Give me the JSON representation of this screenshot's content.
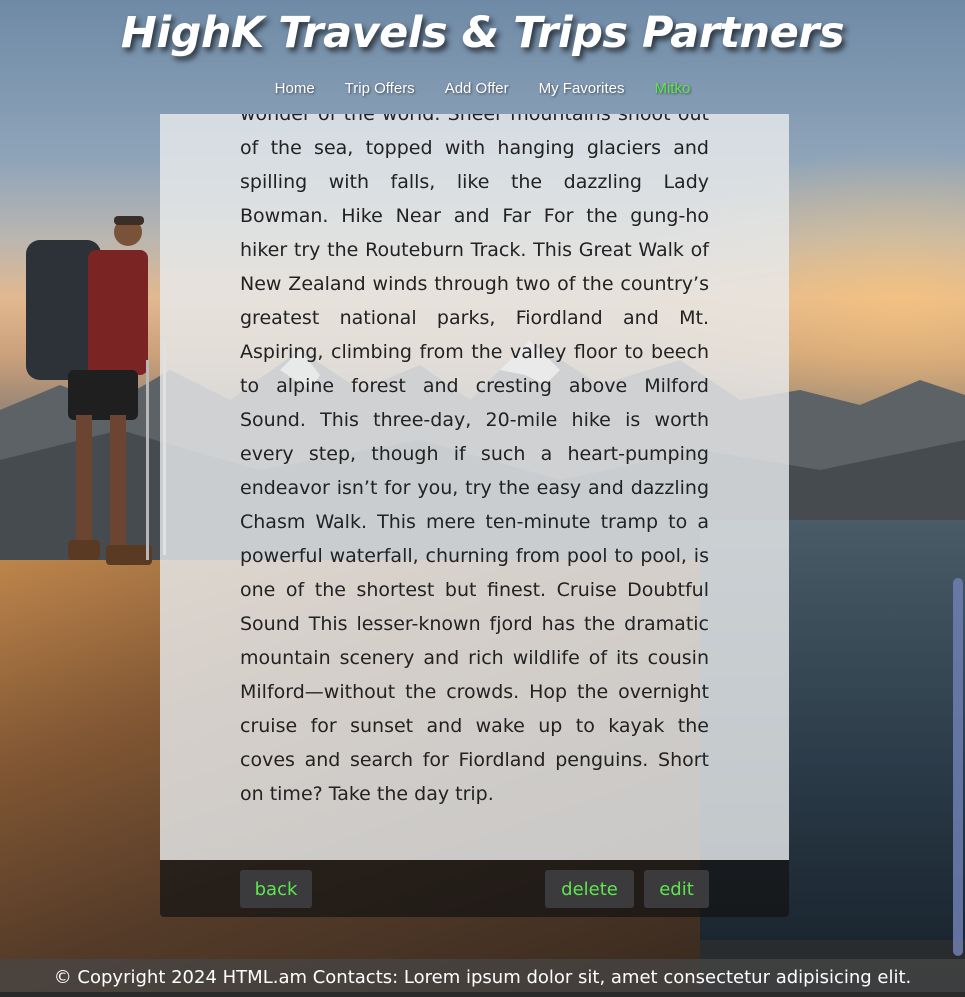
{
  "site": {
    "title": "HighK Travels & Trips Partners"
  },
  "nav": {
    "home": "Home",
    "trip_offers": "Trip Offers",
    "add_offer": "Add Offer",
    "my_favorites": "My Favorites",
    "user": "Mitko"
  },
  "offer": {
    "description": "wonder of the world. Sheer mountains shoot out of the sea, topped with hanging glaciers and spilling with falls, like the dazzling Lady Bowman. Hike Near and Far For the gung-ho hiker try the Routeburn Track. This Great Walk of New Zealand winds through two of the country’s greatest national parks, Fiordland and Mt. Aspiring, climbing from the valley floor to beech to alpine forest and cresting above Milford Sound. This three-day, 20-mile hike is worth every step, though if such a heart-pumping endeavor isn’t for you, try the easy and dazzling Chasm Walk. This mere ten-minute tramp to a powerful waterfall, churning from pool to pool, is one of the shortest but finest. Cruise Doubtful Sound This lesser-known fjord has the dramatic mountain scenery and rich wildlife of its cousin Milford—without the crowds. Hop the overnight cruise for sunset and wake up to kayak the coves and search for Fiordland penguins. Short on time? Take the day trip."
  },
  "actions": {
    "back": "back",
    "delete": "delete",
    "edit": "edit"
  },
  "footer": {
    "text": "© Copyright 2024 HTML.am Contacts: Lorem ipsum dolor sit, amet consectetur adipisicing elit."
  },
  "colors": {
    "accent_green": "#5ee64d",
    "button_bg": "#3b3b3d",
    "card_bg": "#e8eaec"
  }
}
